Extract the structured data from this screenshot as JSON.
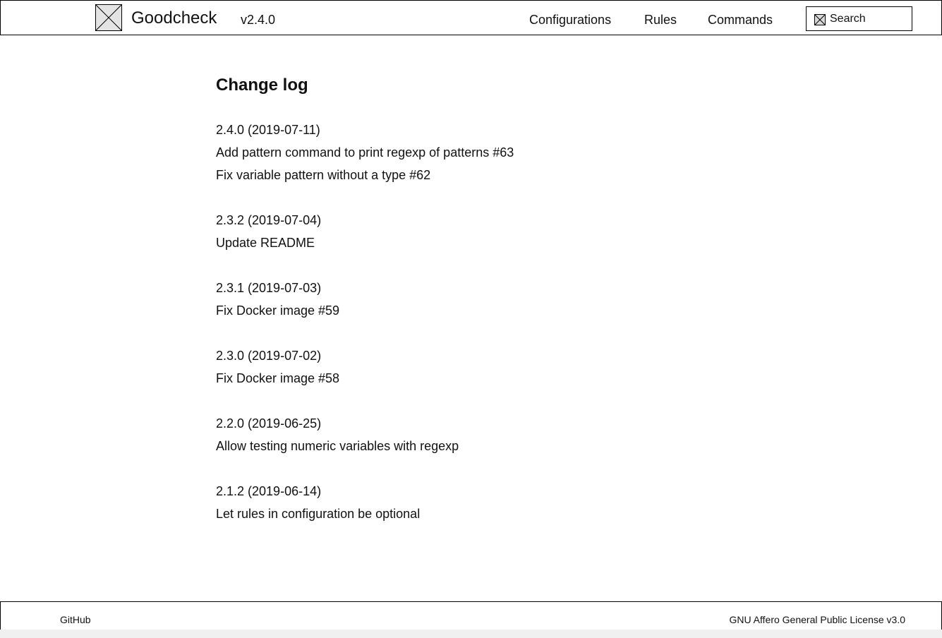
{
  "header": {
    "brand": "Goodcheck",
    "version": "v2.4.0",
    "nav": {
      "configurations": "Configurations",
      "rules": "Rules",
      "commands": "Commands"
    },
    "search": {
      "placeholder": "Search",
      "value": ""
    }
  },
  "main": {
    "title": "Change log",
    "entries": [
      {
        "heading": "2.4.0 (2019-07-11)",
        "items": [
          "Add pattern command to print regexp of patterns #63",
          "Fix variable pattern without a type #62"
        ]
      },
      {
        "heading": "2.3.2 (2019-07-04)",
        "items": [
          "Update README"
        ]
      },
      {
        "heading": "2.3.1 (2019-07-03)",
        "items": [
          "Fix Docker image #59"
        ]
      },
      {
        "heading": "2.3.0 (2019-07-02)",
        "items": [
          "Fix Docker image #58"
        ]
      },
      {
        "heading": "2.2.0 (2019-06-25)",
        "items": [
          "Allow testing numeric variables with regexp"
        ]
      },
      {
        "heading": "2.1.2 (2019-06-14)",
        "items": [
          "Let rules in configuration be optional"
        ]
      }
    ]
  },
  "footer": {
    "github": "GitHub",
    "license": "GNU Affero General Public License v3.0"
  },
  "icons": {
    "logo": "placeholder-image-icon",
    "search": "placeholder-image-icon"
  },
  "colors": {
    "border": "#000000",
    "placeholder_fill": "#e4e4e4",
    "text": "#111111"
  }
}
